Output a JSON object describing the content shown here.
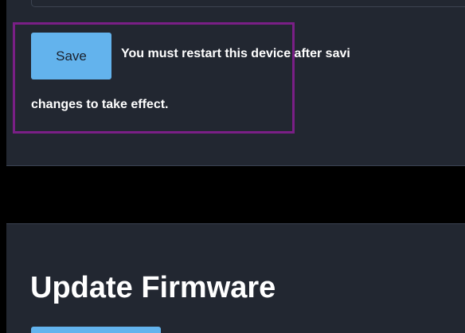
{
  "settings": {
    "save_label": "Save",
    "restart_notice_line1": "You must restart this device after savi",
    "restart_notice_line2": "changes to take effect."
  },
  "firmware": {
    "title": "Update Firmware"
  },
  "colors": {
    "background": "#222731",
    "button": "#63b3ed",
    "highlight": "#7a1f86",
    "band": "#000000"
  }
}
